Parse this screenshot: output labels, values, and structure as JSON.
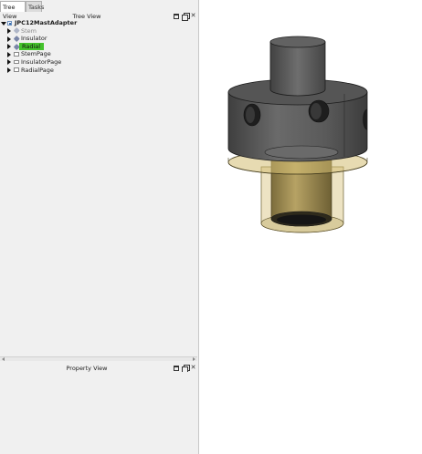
{
  "tabs": [
    {
      "label": "Tree View",
      "active": true
    },
    {
      "label": "Tasks",
      "active": false
    }
  ],
  "tree_view": {
    "title": "Tree View",
    "root": {
      "label": "JPC12MastAdapter",
      "expanded": true
    },
    "items": [
      {
        "label": "Stem",
        "icon": "solid-icon",
        "state": "hidden"
      },
      {
        "label": "Insulator",
        "icon": "solid-icon",
        "state": "normal"
      },
      {
        "label": "Radial",
        "icon": "solid-icon",
        "state": "selected"
      },
      {
        "label": "StemPage",
        "icon": "page-icon",
        "state": "normal"
      },
      {
        "label": "InsulatorPage",
        "icon": "page-icon",
        "state": "normal"
      },
      {
        "label": "RadialPage",
        "icon": "page-icon",
        "state": "normal"
      }
    ]
  },
  "property_view": {
    "title": "Property View"
  },
  "colors": {
    "selection": "#44c22c",
    "panel_bg": "#f0f0f0",
    "model_dark": "#5a5a5a",
    "model_gold": "#a79450"
  }
}
